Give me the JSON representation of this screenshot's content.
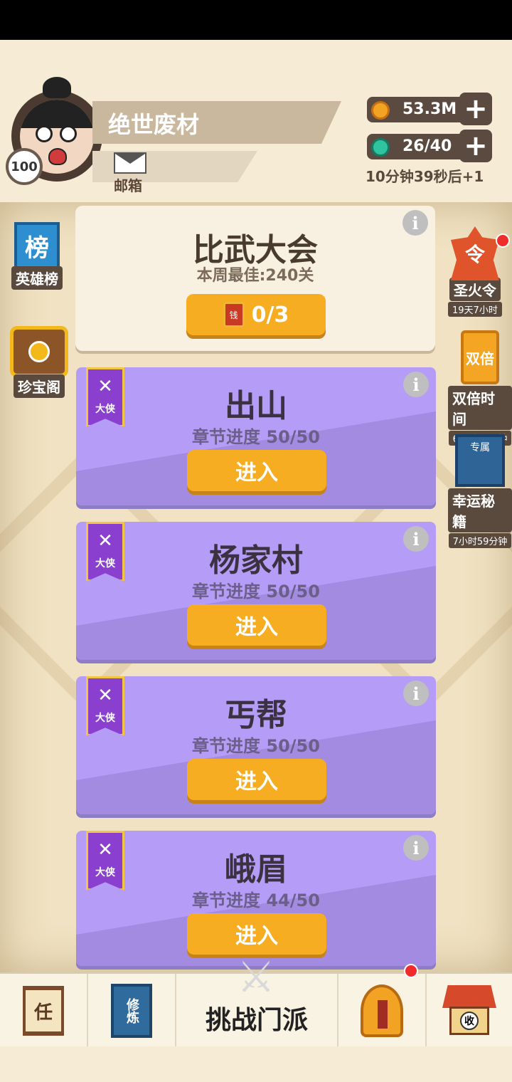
{
  "player": {
    "name": "绝世废材",
    "level": "100",
    "mail_label": "邮箱"
  },
  "resources": {
    "coins": "53.3M",
    "stamina": "26/40",
    "regen_timer": "10分钟39秒后+1"
  },
  "left_side": [
    {
      "label": "英雄榜",
      "icon_text": "榜",
      "icon": "ranking-banner-icon"
    },
    {
      "label": "珍宝阁",
      "icon": "treasure-chest-icon"
    }
  ],
  "right_side": [
    {
      "label": "圣火令",
      "sub": "19天7小时",
      "icon_text": "令",
      "icon": "sacred-fire-icon",
      "has_notification": true
    },
    {
      "label": "双倍时间",
      "sub": "6小时44分钟",
      "icon_text": "双倍",
      "icon": "double-scroll-icon"
    },
    {
      "label": "幸运秘籍",
      "sub": "7小时59分钟",
      "icon_text": "专属",
      "icon": "secret-book-icon"
    }
  ],
  "tournament": {
    "title": "比武大会",
    "best": "本周最佳:240关",
    "ticket_icon_text": "钱",
    "tickets": "0/3"
  },
  "chapters": [
    {
      "title": "出山",
      "progress": "章节进度 50/50",
      "rank": "大侠",
      "button": "进入"
    },
    {
      "title": "杨家村",
      "progress": "章节进度 50/50",
      "rank": "大侠",
      "button": "进入"
    },
    {
      "title": "丐帮",
      "progress": "章节进度 50/50",
      "rank": "大侠",
      "button": "进入"
    },
    {
      "title": "峨眉",
      "progress": "章节进度 44/50",
      "rank": "大侠",
      "button": "进入"
    }
  ],
  "bottom_nav": {
    "tasks_icon_text": "任",
    "cultivate_icon_text": "修炼",
    "challenge_label": "挑战门派",
    "collect_icon_text": "收"
  },
  "colors": {
    "accent_button": "#f6ad22",
    "chapter_card": "#b49cf7",
    "notification": "#ef2b2b"
  }
}
